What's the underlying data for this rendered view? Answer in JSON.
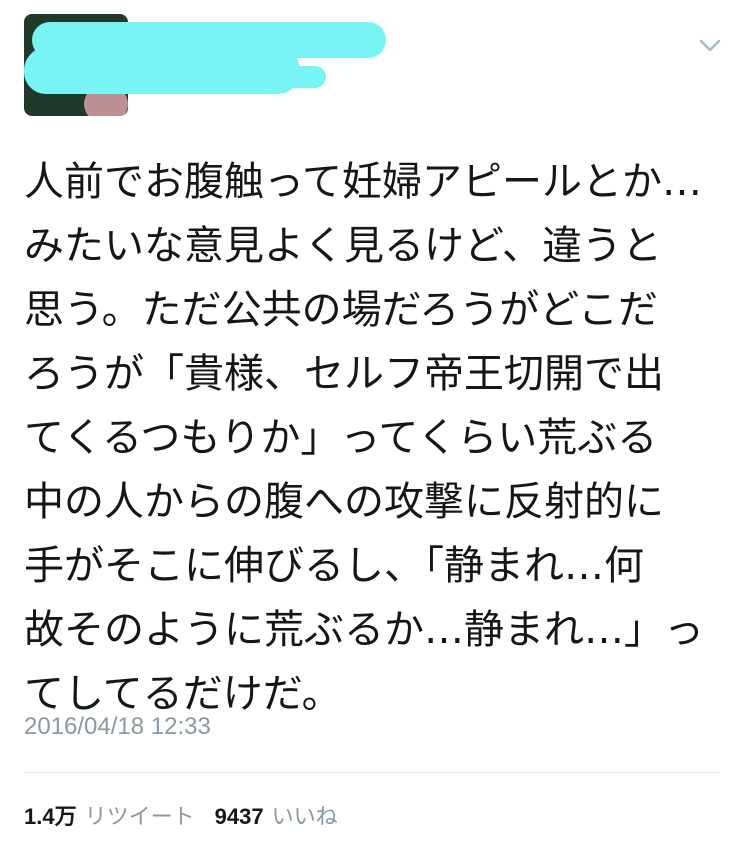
{
  "header": {
    "avatar_icon": "user-avatar",
    "redaction_color": "#79f4f4",
    "menu_icon": "chevron-down-icon"
  },
  "tweet": {
    "text": "人前でお腹触って妊婦アピールとか…\nみたいな意見よく見るけど、違うと\n思う。ただ公共の場だろうがどこだ\nろうが「貴様、セルフ帝王切開で出\nてくるつもりか」ってくらい荒ぶる\n中の人からの腹への攻撃に反射的に\n手がそこに伸びるし、「静まれ…何\n故そのように荒ぶるか…静まれ…」っ\nてしてるだけだ。",
    "timestamp": "2016/04/18 12:33"
  },
  "stats": {
    "retweets_count": "1.4万",
    "retweets_label": "リツイート",
    "likes_count": "9437",
    "likes_label": "いいね"
  },
  "colors": {
    "text": "#14171a",
    "muted": "#8899a6",
    "divider": "#e1e8ed"
  }
}
